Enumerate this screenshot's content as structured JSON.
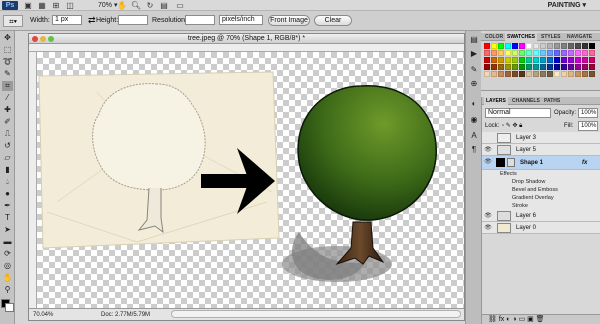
{
  "app": {
    "logo": "Ps",
    "zoom": "70%",
    "workspace": "PAINTING ▾"
  },
  "options": {
    "width_label": "Width:",
    "width_value": "1 px",
    "height_label": "Height:",
    "height_value": "",
    "resolution_label": "Resolution:",
    "resolution_value": "",
    "resolution_unit": "pixels/inch",
    "front_image": "Front Image",
    "clear": "Clear"
  },
  "document": {
    "title": "tree.jpeg @ 70% (Shape 1, RGB/8*) *",
    "zoom_status": "70.04%",
    "doc_status": "Doc: 2.77M/5.79M"
  },
  "swatches": {
    "tabs": [
      "COLOR",
      "SWATCHES",
      "STYLES",
      "NAVIGATE"
    ],
    "colors": [
      "#ff0000",
      "#ffff00",
      "#00ff00",
      "#00ffff",
      "#0000ff",
      "#ff00ff",
      "#ffffff",
      "#e6e6e6",
      "#cccccc",
      "#b3b3b3",
      "#999999",
      "#808080",
      "#666666",
      "#4d4d4d",
      "#333333",
      "#000000",
      "#ff6666",
      "#ff9966",
      "#ffcc66",
      "#ffff66",
      "#ccff66",
      "#66ff66",
      "#66ffcc",
      "#66ffff",
      "#66ccff",
      "#6699ff",
      "#6666ff",
      "#9966ff",
      "#cc66ff",
      "#ff66ff",
      "#ff66cc",
      "#ff6699",
      "#cc0000",
      "#cc6600",
      "#cc9900",
      "#cccc00",
      "#99cc00",
      "#00cc00",
      "#00cc99",
      "#00cccc",
      "#0099cc",
      "#0066cc",
      "#0000cc",
      "#6600cc",
      "#9900cc",
      "#cc00cc",
      "#cc0099",
      "#cc0066",
      "#990000",
      "#993300",
      "#996600",
      "#999900",
      "#669900",
      "#009900",
      "#009966",
      "#009999",
      "#006699",
      "#003399",
      "#000099",
      "#330099",
      "#660099",
      "#990099",
      "#990066",
      "#990033",
      "#f4d7b0",
      "#e8b98a",
      "#c98b5a",
      "#a0653a",
      "#7a4a2a",
      "#5a3520",
      "#d9c3a0",
      "#b8a07a",
      "#8c7a5a",
      "#6e5e44",
      "#fbe9c8",
      "#f1d1a5",
      "#e2b680",
      "#c8945e",
      "#a8743f",
      "#7c5230"
    ]
  },
  "layers_panel": {
    "tabs": [
      "LAYERS",
      "CHANNELS",
      "PATHS"
    ],
    "blend_mode": "Normal",
    "opacity_label": "Opacity:",
    "opacity_value": "100%",
    "lock_label": "Lock:",
    "fill_label": "Fill:",
    "fill_value": "100%",
    "layers": [
      {
        "name": "Layer 3",
        "visible": false
      },
      {
        "name": "Layer 5",
        "visible": true
      },
      {
        "name": "Shape 1",
        "visible": true,
        "selected": true,
        "fx": "fx"
      },
      {
        "name": "Layer 6",
        "visible": true
      },
      {
        "name": "Layer 0",
        "visible": true
      }
    ],
    "effects": {
      "label": "Effects",
      "items": [
        "Drop Shadow",
        "Bevel and Emboss",
        "Gradient Overlay",
        "Stroke"
      ]
    }
  }
}
